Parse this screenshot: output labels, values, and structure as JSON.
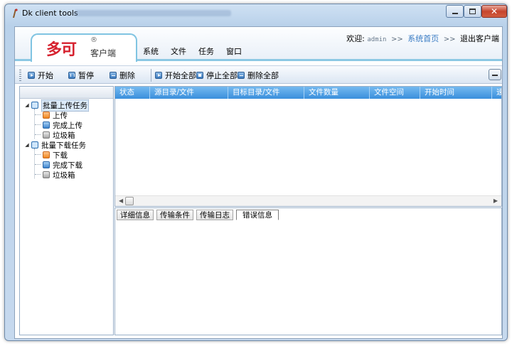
{
  "window": {
    "title": "Dk client tools"
  },
  "header": {
    "logo_main": "多可",
    "logo_reg": "®",
    "logo_sub": "客户端",
    "menu": [
      {
        "label": "系统"
      },
      {
        "label": "文件"
      },
      {
        "label": "任务"
      },
      {
        "label": "窗口"
      }
    ],
    "welcome_label": "欢迎:",
    "username": "admin",
    "separator": ">>",
    "home_link": "系统首页",
    "exit_link": "退出客户端"
  },
  "toolbar": {
    "start_label": "开始",
    "pause_label": "暂停",
    "delete_label": "删除",
    "start_all_label": "开始全部",
    "stop_all_label": "停止全部",
    "delete_all_label": "删除全部"
  },
  "tree": {
    "upload_group": "批量上传任务",
    "upload": "上传",
    "upload_done": "完成上传",
    "upload_trash": "垃圾箱",
    "download_group": "批量下载任务",
    "download": "下载",
    "download_done": "完成下载",
    "download_trash": "垃圾箱"
  },
  "grid": {
    "columns": [
      "状态",
      "源目录/文件",
      "目标目录/文件",
      "文件数量",
      "文件空间",
      "开始时间",
      "速"
    ]
  },
  "detail_tabs": [
    {
      "label": "详细信息"
    },
    {
      "label": "传输条件"
    },
    {
      "label": "传输日志"
    },
    {
      "label": "错误信息"
    }
  ],
  "colors": {
    "logo_red": "#d6212e",
    "grid_header": "#4a9de2",
    "accent_blue": "#3a7cc4"
  }
}
